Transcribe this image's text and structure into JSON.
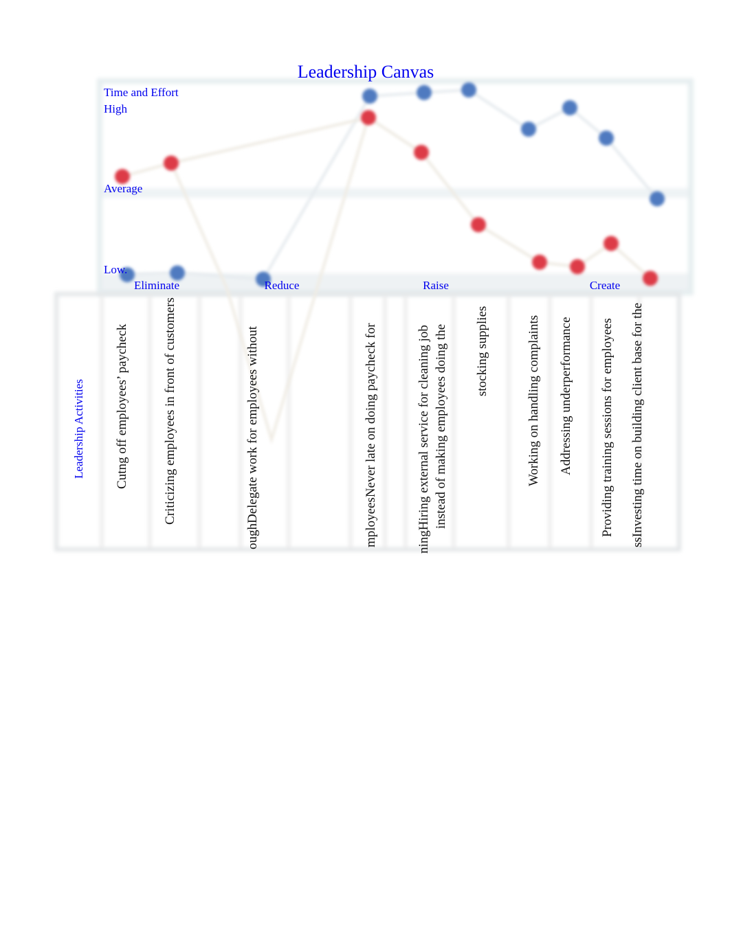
{
  "chart_data": {
    "type": "line",
    "title": "Leadership Canvas",
    "ylabel": "Time and Effort",
    "xlabel": "Leadership Activities",
    "y_levels": [
      "Low.",
      "Average",
      "High"
    ],
    "ylim": [
      1,
      3
    ],
    "grid": true,
    "groups": [
      "Eliminate",
      "Reduce",
      "Raise",
      "Create"
    ],
    "categories": [
      "Cutng off employees’ paycheck",
      "Criticizing employees in front of customers",
      "oughDelegate work for employees without",
      "mployeesNever late on doing paycheck for",
      "ningHiring external service for cleaning job instead of making employees doing the",
      "stocking supplies",
      "Working on handling complaints",
      "Addressing underperformance",
      "Providing training sessions for employees",
      "ssInvesting time on building client base for the"
    ],
    "series": [
      {
        "name": "blue",
        "color": "#4f7ac0",
        "values": [
          1.0,
          1.02,
          0.95,
          3.0,
          3.04,
          3.07,
          2.63,
          2.87,
          2.53,
          1.85
        ]
      },
      {
        "name": "red",
        "color": "#dd3a46",
        "values": [
          2.1,
          2.25,
          null,
          2.76,
          2.37,
          1.56,
          1.14,
          1.09,
          1.35,
          0.96
        ]
      }
    ]
  }
}
